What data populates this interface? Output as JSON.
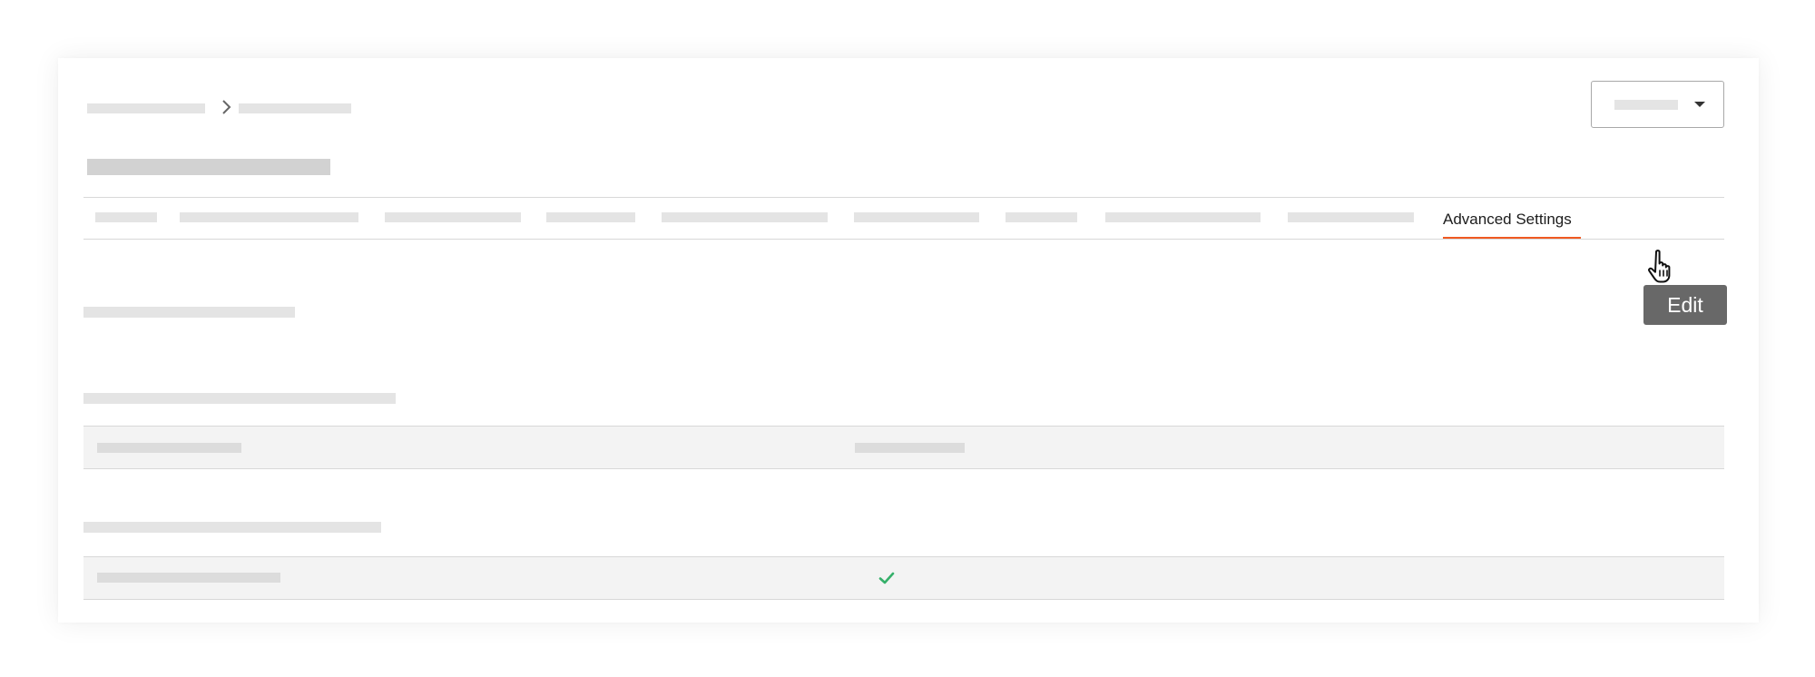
{
  "header": {
    "breadcrumb_icon": "chevron-right-icon",
    "dropdown_icon": "caret-down-icon"
  },
  "tabs": {
    "active_label": "Advanced Settings"
  },
  "toolbar": {
    "edit_label": "Edit"
  },
  "settings": {
    "checked_icon": "check-icon"
  },
  "colors": {
    "accent": "#f05a22",
    "button": "#686868",
    "check": "#35b06a",
    "row_background": "#f3f3f3"
  }
}
